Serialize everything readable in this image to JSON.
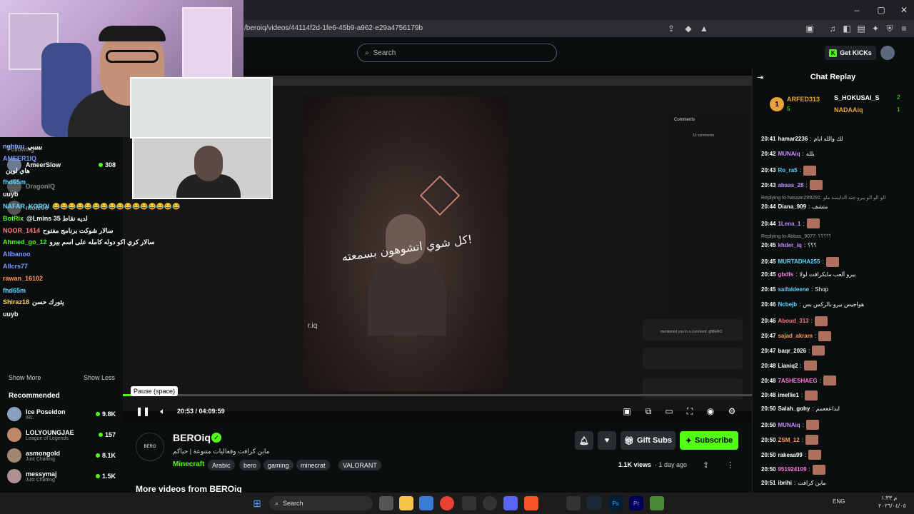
{
  "browser": {
    "url": "/beroiq/videos/44114f2d-1fe6-45b9-a962-e29a4756179b"
  },
  "header": {
    "search_placeholder": "Search",
    "get_kicks": "Get KICKs"
  },
  "overlay_chat": [
    {
      "user": "nghtuu",
      "color": "#8ab4ff",
      "text": "بيبيبي"
    },
    {
      "user": "AMEER1IQ",
      "color": "#7a9cff",
      "text": ""
    },
    {
      "user": "",
      "color": "#fff",
      "text": "هاي لوين"
    },
    {
      "user": "fhd65m",
      "color": "#5ad6ff",
      "text": ""
    },
    {
      "user": "uuyb",
      "color": "#fff",
      "text": ""
    },
    {
      "user": "NAFAR_KORDI",
      "color": "#5ad6ff",
      "text": "😂😂😂😂😂😂😂😂😂😂😂😂😂😂😂😂"
    },
    {
      "user": "BotRix",
      "color": "#53fc18",
      "text": "@Lmins لديه نقاط 35"
    },
    {
      "user": "NOOR_1414",
      "color": "#ff7a7a",
      "text": "سالار شوكت برنامج مفتوح"
    },
    {
      "user": "Ahmed_go_12",
      "color": "#53fc18",
      "text": "سالار كري اكو دوله كامله على اسم بيرو"
    },
    {
      "user": "Alibanoo",
      "color": "#7a9cff",
      "text": ""
    },
    {
      "user": "Allcrs77",
      "color": "#7a9cff",
      "text": ""
    },
    {
      "user": "rawan_16102",
      "color": "#ff9a5a",
      "text": ""
    },
    {
      "user": "fhd65m",
      "color": "#5ad6ff",
      "text": ""
    },
    {
      "user": "Shiraz18",
      "color": "#ffd86a",
      "text": "يثورك حسن"
    },
    {
      "user": "uuyb",
      "color": "#fff",
      "text": ""
    }
  ],
  "sidebar": {
    "following_label": "Following",
    "following": [
      {
        "name": "AmeerSlow",
        "sub": "",
        "viewers": "308",
        "live": true,
        "color": "#6b7a8c"
      },
      {
        "name": "DragonIQ",
        "sub": "",
        "viewers": "",
        "live": false,
        "color": "#555"
      },
      {
        "name": "mote00",
        "sub": "",
        "viewers": "",
        "live": false,
        "color": "#555"
      }
    ],
    "show_more": "Show More",
    "show_less": "Show Less",
    "recommended_label": "Recommended",
    "recommended": [
      {
        "name": "Ice Poseidon",
        "sub": "IRL",
        "viewers": "9.8K",
        "color": "#8aa0c0"
      },
      {
        "name": "LOLYOUNGJAE",
        "sub": "League of Legends",
        "viewers": "157",
        "color": "#c08a6a"
      },
      {
        "name": "asmongold",
        "sub": "Just Chatting",
        "viewers": "8.1K",
        "color": "#a08870"
      },
      {
        "name": "messymaj",
        "sub": "Just Chatting",
        "viewers": "1.5K",
        "color": "#b09090"
      }
    ]
  },
  "video": {
    "overlay_text": "كل شوي اتشوهون بسمعته!",
    "watermark": "r.iq",
    "tooltip": "Pause (space)",
    "current_time": "20:53",
    "duration": "04:09:59",
    "progress_fraction": 0.014,
    "comments_header": "Comments",
    "comments_count": "15 comments",
    "notif_text": "mentioned you in a comment: @BERO"
  },
  "channel": {
    "name": "BEROiq",
    "logo_text": "BERO",
    "description": "ماين كرافت وفعاليات متنوعة | حياكم",
    "category": "Minecraft",
    "tags": [
      "Arabic",
      "bero",
      "gaming",
      "minecrat",
      "VALORANT"
    ],
    "views": "1.1K views",
    "age": "1 day ago",
    "gift_subs": "Gift Subs",
    "subscribe": "Subscribe",
    "more_videos": "More videos from BEROiq"
  },
  "chat": {
    "title": "Chat Replay",
    "leaderboard": [
      {
        "rank": "1",
        "name": "ARFED313",
        "count": "5",
        "color": "#e8a33a"
      },
      {
        "name": "S_HOKUSAI_S",
        "count": "2"
      },
      {
        "name": "NADAAiq",
        "count": "1"
      }
    ],
    "messages": [
      {
        "time": "20:41",
        "user": "hamar2236",
        "color": "#fff",
        "text": "لك والله ايام",
        "emote": false,
        "reply": ""
      },
      {
        "time": "20:42",
        "user": "MUNAiq",
        "color": "#c28cff",
        "text": "يلله",
        "emote": false,
        "reply": ""
      },
      {
        "time": "20:43",
        "user": "Ro_ra5",
        "color": "#5ad6ff",
        "text": "",
        "emote": true,
        "reply": ""
      },
      {
        "time": "20:43",
        "user": "abaas_28",
        "color": "#c28cff",
        "text": "",
        "emote": true,
        "reply": ""
      },
      {
        "time": "",
        "user": "",
        "color": "#9a9a9a",
        "text": "",
        "emote": false,
        "reply": "Replying to hassan299291: الو الو الو بيرو جنه الدايسة ملو"
      },
      {
        "time": "20:44",
        "user": "Diana_909",
        "color": "#fff",
        "text": "متشف",
        "emote": false,
        "reply": ""
      },
      {
        "time": "20:44",
        "user": "1Lena_1",
        "color": "#c28cff",
        "text": "",
        "emote": true,
        "reply": ""
      },
      {
        "time": "",
        "user": "",
        "color": "#9a9a9a",
        "text": "",
        "emote": false,
        "reply": "Replying to Abbas_9077: ؟؟؟؟؟"
      },
      {
        "time": "20:45",
        "user": "khder_iq",
        "color": "#c28cff",
        "text": "؟؟؟",
        "emote": false,
        "reply": ""
      },
      {
        "time": "20:45",
        "user": "MURTADHA255",
        "color": "#5ad6ff",
        "text": "",
        "emote": true,
        "reply": ""
      },
      {
        "time": "20:45",
        "user": "gbdfs",
        "color": "#ff7ad9",
        "text": "بيرو ألعب مايكرافت لولا",
        "emote": false,
        "reply": ""
      },
      {
        "time": "20:45",
        "user": "saifaldeene",
        "color": "#5ad6ff",
        "text": "Shop",
        "emote": false,
        "reply": ""
      },
      {
        "time": "20:46",
        "user": "Ncbejb",
        "color": "#5ad6ff",
        "text": "هواجيس بيرو بالركس بس",
        "emote": false,
        "reply": ""
      },
      {
        "time": "20:46",
        "user": "Aboud_313",
        "color": "#ff7a7a",
        "text": "",
        "emote": true,
        "reply": ""
      },
      {
        "time": "20:47",
        "user": "sajad_akram",
        "color": "#ff9a5a",
        "text": "",
        "emote": true,
        "reply": ""
      },
      {
        "time": "20:47",
        "user": "baqr_2026",
        "color": "#fff",
        "text": "",
        "emote": true,
        "reply": ""
      },
      {
        "time": "20:48",
        "user": "Lianiq2",
        "color": "#fff",
        "text": "",
        "emote": true,
        "reply": ""
      },
      {
        "time": "20:48",
        "user": "7ASHESHAEG",
        "color": "#ff7ad9",
        "text": "",
        "emote": true,
        "reply": ""
      },
      {
        "time": "20:48",
        "user": "imellie1",
        "color": "#fff",
        "text": "",
        "emote": true,
        "reply": ""
      },
      {
        "time": "20:50",
        "user": "Salah_gohy",
        "color": "#fff",
        "text": "ابداعععمم",
        "emote": false,
        "reply": ""
      },
      {
        "time": "20:50",
        "user": "MUNAiq",
        "color": "#c28cff",
        "text": "",
        "emote": true,
        "reply": ""
      },
      {
        "time": "20:50",
        "user": "ZSM_12",
        "color": "#ff9a5a",
        "text": "",
        "emote": true,
        "reply": ""
      },
      {
        "time": "20:50",
        "user": "rakeaa99",
        "color": "#fff",
        "text": "",
        "emote": true,
        "reply": ""
      },
      {
        "time": "20:50",
        "user": "951924109",
        "color": "#ff7ad9",
        "text": "",
        "emote": true,
        "reply": ""
      },
      {
        "time": "20:51",
        "user": "ibrihi",
        "color": "#fff",
        "text": "ماين كرافت",
        "emote": false,
        "reply": ""
      }
    ]
  },
  "taskbar": {
    "search": "Search",
    "lang": "ENG",
    "time": "م ١:٣٣",
    "date": "٢٠٢٦/٠٤/٠٥"
  },
  "colors": {
    "accent": "#53fc18",
    "bg": "#0b0e0f"
  }
}
